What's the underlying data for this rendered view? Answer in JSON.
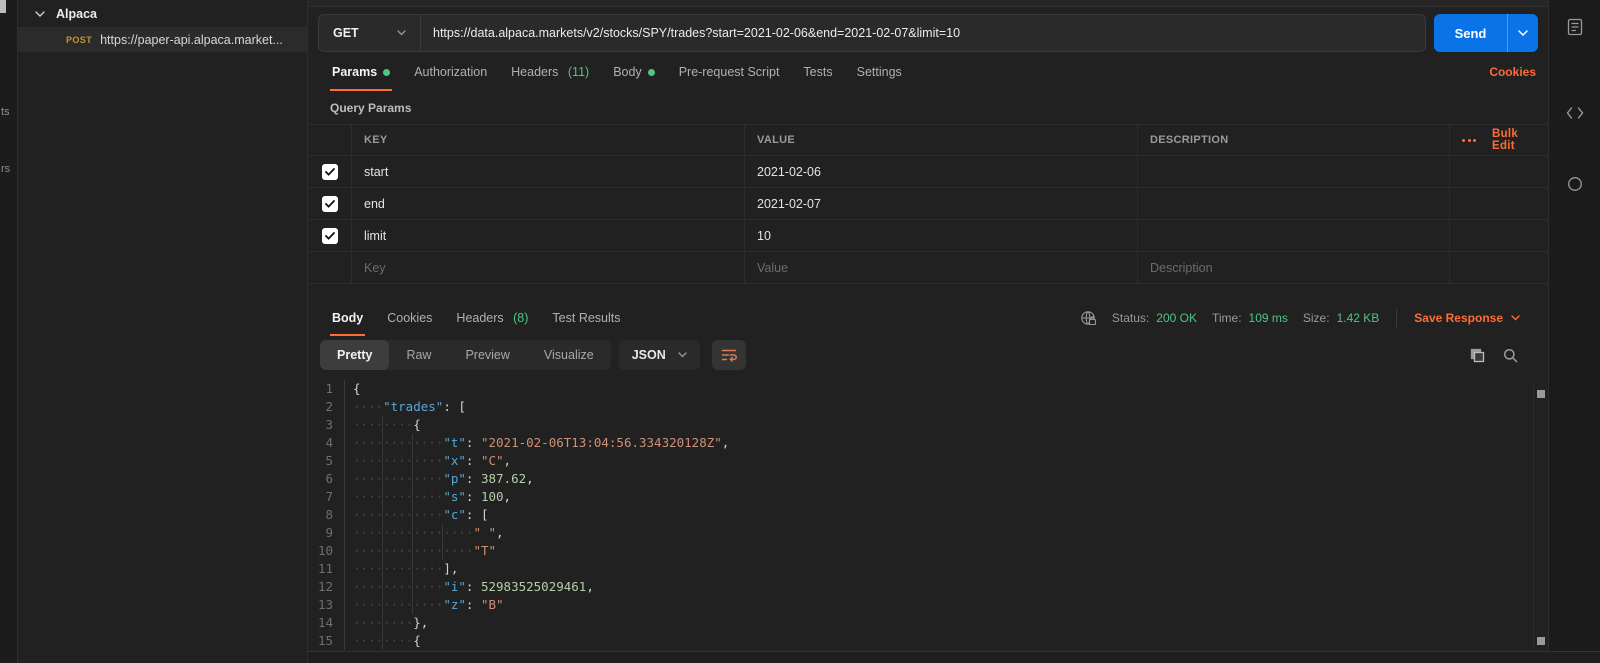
{
  "colors": {
    "accent_orange": "#ff6c37",
    "send_blue": "#0a73e8",
    "success_green": "#4ec583",
    "post_gold": "#c79428",
    "json_key": "#58a6d8",
    "json_string": "#ce9178",
    "json_number": "#b5cea8"
  },
  "left_rail": {
    "fragments": [
      "ts",
      "rs"
    ]
  },
  "sidebar": {
    "collection_name": "Alpaca",
    "request": {
      "method": "POST",
      "label": "https://paper-api.alpaca.market..."
    }
  },
  "request_bar": {
    "method": "GET",
    "url": "https://data.alpaca.markets/v2/stocks/SPY/trades?start=2021-02-06&end=2021-02-07&limit=10",
    "send_label": "Send"
  },
  "request_tabs": [
    {
      "label": "Params",
      "dot": true,
      "active": true
    },
    {
      "label": "Authorization"
    },
    {
      "label": "Headers",
      "count": "(11)"
    },
    {
      "label": "Body",
      "dot": true
    },
    {
      "label": "Pre-request Script"
    },
    {
      "label": "Tests"
    },
    {
      "label": "Settings"
    }
  ],
  "cookies_link": "Cookies",
  "query_params": {
    "section_label": "Query Params",
    "columns": [
      "KEY",
      "VALUE",
      "DESCRIPTION"
    ],
    "bulk_edit_label": "Bulk Edit",
    "rows": [
      {
        "checked": true,
        "key": "start",
        "value": "2021-02-06",
        "description": ""
      },
      {
        "checked": true,
        "key": "end",
        "value": "2021-02-07",
        "description": ""
      },
      {
        "checked": true,
        "key": "limit",
        "value": "10",
        "description": ""
      }
    ],
    "placeholder_row": {
      "key": "Key",
      "value": "Value",
      "description": "Description"
    }
  },
  "response": {
    "tabs": [
      {
        "label": "Body",
        "active": true
      },
      {
        "label": "Cookies"
      },
      {
        "label": "Headers",
        "count": "(8)"
      },
      {
        "label": "Test Results"
      }
    ],
    "meta": {
      "status_label": "Status:",
      "status_value": "200 OK",
      "time_label": "Time:",
      "time_value": "109 ms",
      "size_label": "Size:",
      "size_value": "1.42 KB"
    },
    "save_label": "Save Response",
    "view_tabs": [
      {
        "label": "Pretty",
        "active": true
      },
      {
        "label": "Raw"
      },
      {
        "label": "Preview"
      },
      {
        "label": "Visualize"
      }
    ],
    "format": "JSON",
    "body_lines": [
      {
        "n": 1,
        "indent": 0,
        "segs": [
          [
            "{",
            "pn"
          ]
        ]
      },
      {
        "n": 2,
        "indent": 1,
        "segs": [
          [
            "\"trades\"",
            "key"
          ],
          [
            ": [",
            "pn"
          ]
        ]
      },
      {
        "n": 3,
        "indent": 2,
        "segs": [
          [
            "{",
            "pn"
          ]
        ]
      },
      {
        "n": 4,
        "indent": 3,
        "segs": [
          [
            "\"t\"",
            "key"
          ],
          [
            ": ",
            "pn"
          ],
          [
            "\"2021-02-06T13:04:56.334320128Z\"",
            "str"
          ],
          [
            ",",
            "pn"
          ]
        ]
      },
      {
        "n": 5,
        "indent": 3,
        "segs": [
          [
            "\"x\"",
            "key"
          ],
          [
            ": ",
            "pn"
          ],
          [
            "\"C\"",
            "str"
          ],
          [
            ",",
            "pn"
          ]
        ]
      },
      {
        "n": 6,
        "indent": 3,
        "segs": [
          [
            "\"p\"",
            "key"
          ],
          [
            ": ",
            "pn"
          ],
          [
            "387.62",
            "num"
          ],
          [
            ",",
            "pn"
          ]
        ]
      },
      {
        "n": 7,
        "indent": 3,
        "segs": [
          [
            "\"s\"",
            "key"
          ],
          [
            ": ",
            "pn"
          ],
          [
            "100",
            "num"
          ],
          [
            ",",
            "pn"
          ]
        ]
      },
      {
        "n": 8,
        "indent": 3,
        "segs": [
          [
            "\"c\"",
            "key"
          ],
          [
            ": [",
            "pn"
          ]
        ]
      },
      {
        "n": 9,
        "indent": 4,
        "segs": [
          [
            "\" \"",
            "str"
          ],
          [
            ",",
            "pn"
          ]
        ]
      },
      {
        "n": 10,
        "indent": 4,
        "segs": [
          [
            "\"T\"",
            "str"
          ]
        ]
      },
      {
        "n": 11,
        "indent": 3,
        "segs": [
          [
            "],",
            "pn"
          ]
        ]
      },
      {
        "n": 12,
        "indent": 3,
        "segs": [
          [
            "\"i\"",
            "key"
          ],
          [
            ": ",
            "pn"
          ],
          [
            "52983525029461",
            "num"
          ],
          [
            ",",
            "pn"
          ]
        ]
      },
      {
        "n": 13,
        "indent": 3,
        "segs": [
          [
            "\"z\"",
            "key"
          ],
          [
            ": ",
            "pn"
          ],
          [
            "\"B\"",
            "str"
          ]
        ]
      },
      {
        "n": 14,
        "indent": 2,
        "segs": [
          [
            "},",
            "pn"
          ]
        ]
      },
      {
        "n": 15,
        "indent": 2,
        "segs": [
          [
            "{",
            "pn"
          ]
        ]
      }
    ]
  }
}
